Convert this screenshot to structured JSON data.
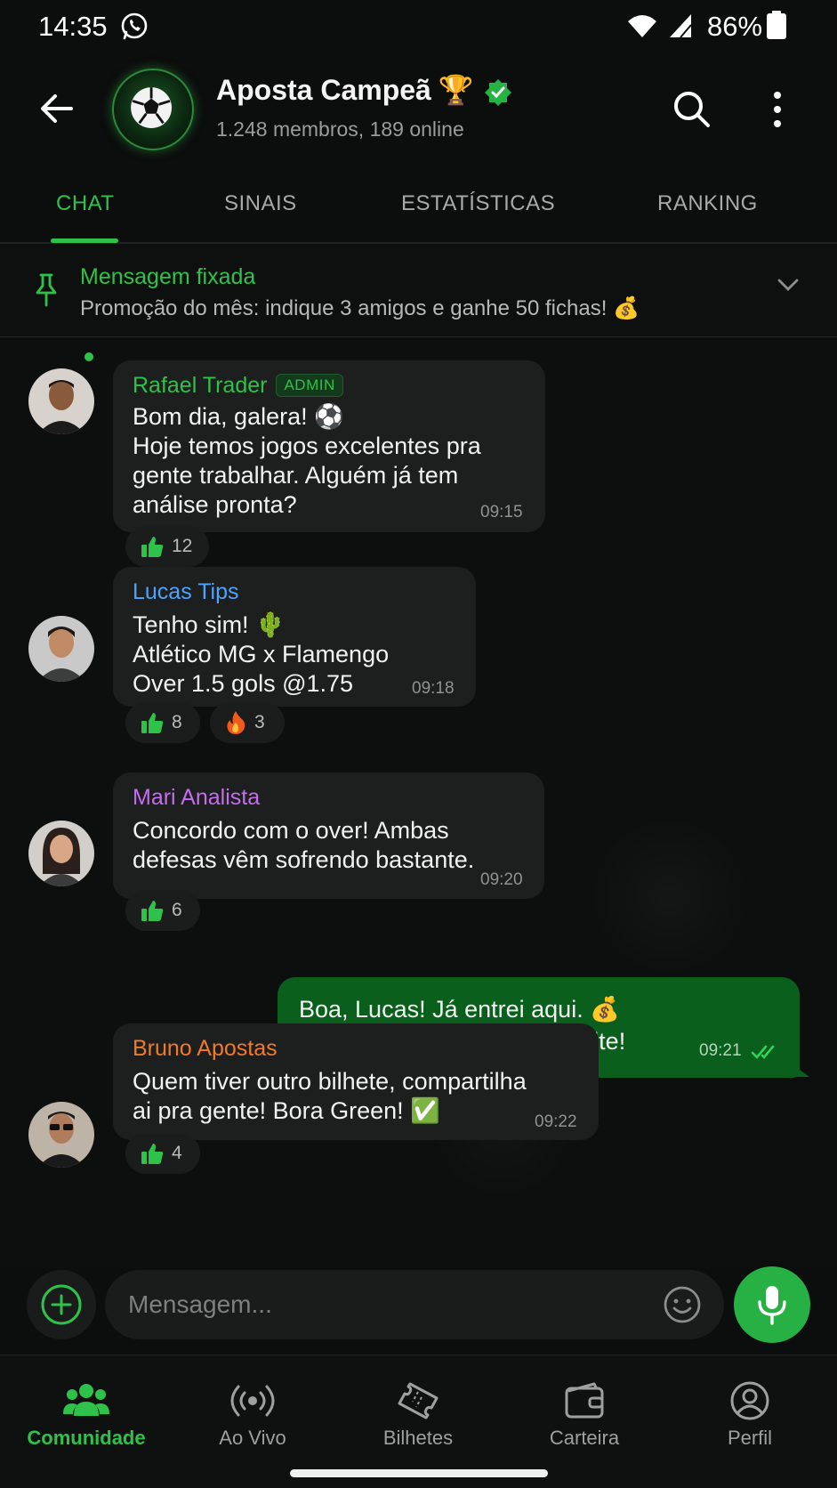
{
  "status_bar": {
    "time": "14:35",
    "battery": "86%",
    "icons": [
      "whatsapp-icon",
      "wifi-icon",
      "signal-icon",
      "battery-icon"
    ]
  },
  "header": {
    "group_name": "Aposta Campeã",
    "trophy": "🏆",
    "subtitle": "1.248 membros, 189 online",
    "icons": [
      "back-arrow-icon",
      "soccer-ball-icon",
      "verified-icon",
      "search-icon",
      "more-vert-icon"
    ]
  },
  "tabs": [
    {
      "label": "CHAT",
      "active": true
    },
    {
      "label": "SINAIS",
      "active": false
    },
    {
      "label": "ESTATÍSTICAS",
      "active": false
    },
    {
      "label": "RANKING",
      "active": false
    }
  ],
  "pinned": {
    "title": "Mensagem fixada",
    "text": "Promoção do mês: indique 3 amigos e ganhe 50 fichas! 💰"
  },
  "messages": [
    {
      "sender": "Rafael Trader",
      "sender_color": "#2fc24a",
      "badge": "ADMIN",
      "lines": [
        "Bom dia, galera! ⚽",
        "Hoje temos jogos excelentes pra",
        "gente trabalhar. Alguém já tem",
        "análise pronta?"
      ],
      "time": "09:15",
      "reactions": [
        {
          "icon": "thumbs-up-icon",
          "count": "12"
        }
      ]
    },
    {
      "sender": "Lucas Tips",
      "sender_color": "#4da3ff",
      "lines": [
        "Tenho sim! 🌵",
        "Atlético MG x Flamengo",
        "Over 1.5 gols @1.75"
      ],
      "time": "09:18",
      "reactions": [
        {
          "icon": "thumbs-up-icon",
          "count": "8"
        },
        {
          "icon": "fire-icon",
          "count": "3"
        }
      ]
    },
    {
      "sender": "Mari Analista",
      "sender_color": "#c56cf0",
      "lines": [
        "Concordo com o over! Ambas",
        "defesas vêm sofrendo bastante."
      ],
      "time": "09:20",
      "reactions": [
        {
          "icon": "thumbs-up-icon",
          "count": "6"
        }
      ]
    },
    {
      "outgoing": true,
      "lines": [
        "Boa, Lucas! Já entrei aqui. 💰",
        "Vamos com responsabilidadte!"
      ],
      "time": "09:21",
      "status_icon": "double-check-icon"
    },
    {
      "sender": "Bruno Apostas",
      "sender_color": "#f07a2a",
      "lines": [
        "Quem tiver outro bilhete, compartilha",
        "ai pra gente! Bora Green! ✅"
      ],
      "time": "09:22",
      "reactions": [
        {
          "icon": "thumbs-up-icon",
          "count": "4"
        }
      ]
    }
  ],
  "composer": {
    "placeholder": "Mensagem...",
    "icons": [
      "plus-circle-icon",
      "emoji-icon",
      "microphone-icon"
    ]
  },
  "bottom_nav": [
    {
      "label": "Comunidade",
      "icon": "community-icon",
      "active": true
    },
    {
      "label": "Ao Vivo",
      "icon": "live-broadcast-icon",
      "active": false
    },
    {
      "label": "Bilhetes",
      "icon": "ticket-icon",
      "active": false
    },
    {
      "label": "Carteira",
      "icon": "wallet-icon",
      "active": false
    },
    {
      "label": "Perfil",
      "icon": "profile-icon",
      "active": false
    }
  ],
  "colors": {
    "accent": "#2fc24a",
    "background": "#0c0d0d",
    "bubble_in": "#1d1f1e",
    "bubble_out": "#0b5f1d"
  }
}
